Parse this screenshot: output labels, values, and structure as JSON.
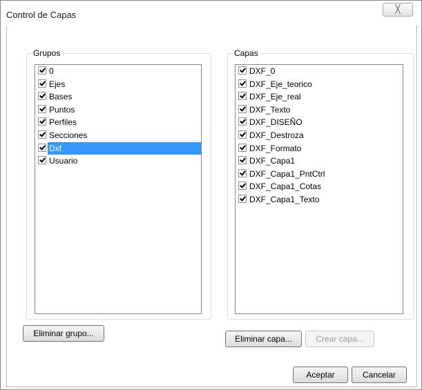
{
  "window": {
    "title": "Control de Capas",
    "close_glyph": "╳"
  },
  "grupos": {
    "label": "Grupos",
    "items": [
      {
        "label": "0",
        "checked": true
      },
      {
        "label": "Ejes",
        "checked": true
      },
      {
        "label": "Bases",
        "checked": true
      },
      {
        "label": "Puntos",
        "checked": true
      },
      {
        "label": "Perfiles",
        "checked": true
      },
      {
        "label": "Secciones",
        "checked": true
      },
      {
        "label": "Dxf",
        "checked": true,
        "selected": true
      },
      {
        "label": "Usuario",
        "checked": true
      }
    ],
    "delete_label": "Eliminar grupo..."
  },
  "capas": {
    "label": "Capas",
    "items": [
      {
        "label": "DXF_0",
        "checked": true
      },
      {
        "label": "DXF_Eje_teorico",
        "checked": true
      },
      {
        "label": "DXF_Eje_real",
        "checked": true
      },
      {
        "label": "DXF_Texto",
        "checked": true
      },
      {
        "label": "DXF_DISEÑO",
        "checked": true
      },
      {
        "label": "DXF_Destroza",
        "checked": true
      },
      {
        "label": "DXF_Formato",
        "checked": true
      },
      {
        "label": "DXF_Capa1",
        "checked": true
      },
      {
        "label": "DXF_Capa1_PntCtrl",
        "checked": true
      },
      {
        "label": "DXF_Capa1_Cotas",
        "checked": true
      },
      {
        "label": "DXF_Capa1_Texto",
        "checked": true
      }
    ],
    "delete_label": "Eliminar capa...",
    "create_label": "Crear capa..."
  },
  "footer": {
    "ok_label": "Aceptar",
    "cancel_label": "Cancelar"
  },
  "colors": {
    "selection": "#3399ff",
    "border": "#828790"
  }
}
